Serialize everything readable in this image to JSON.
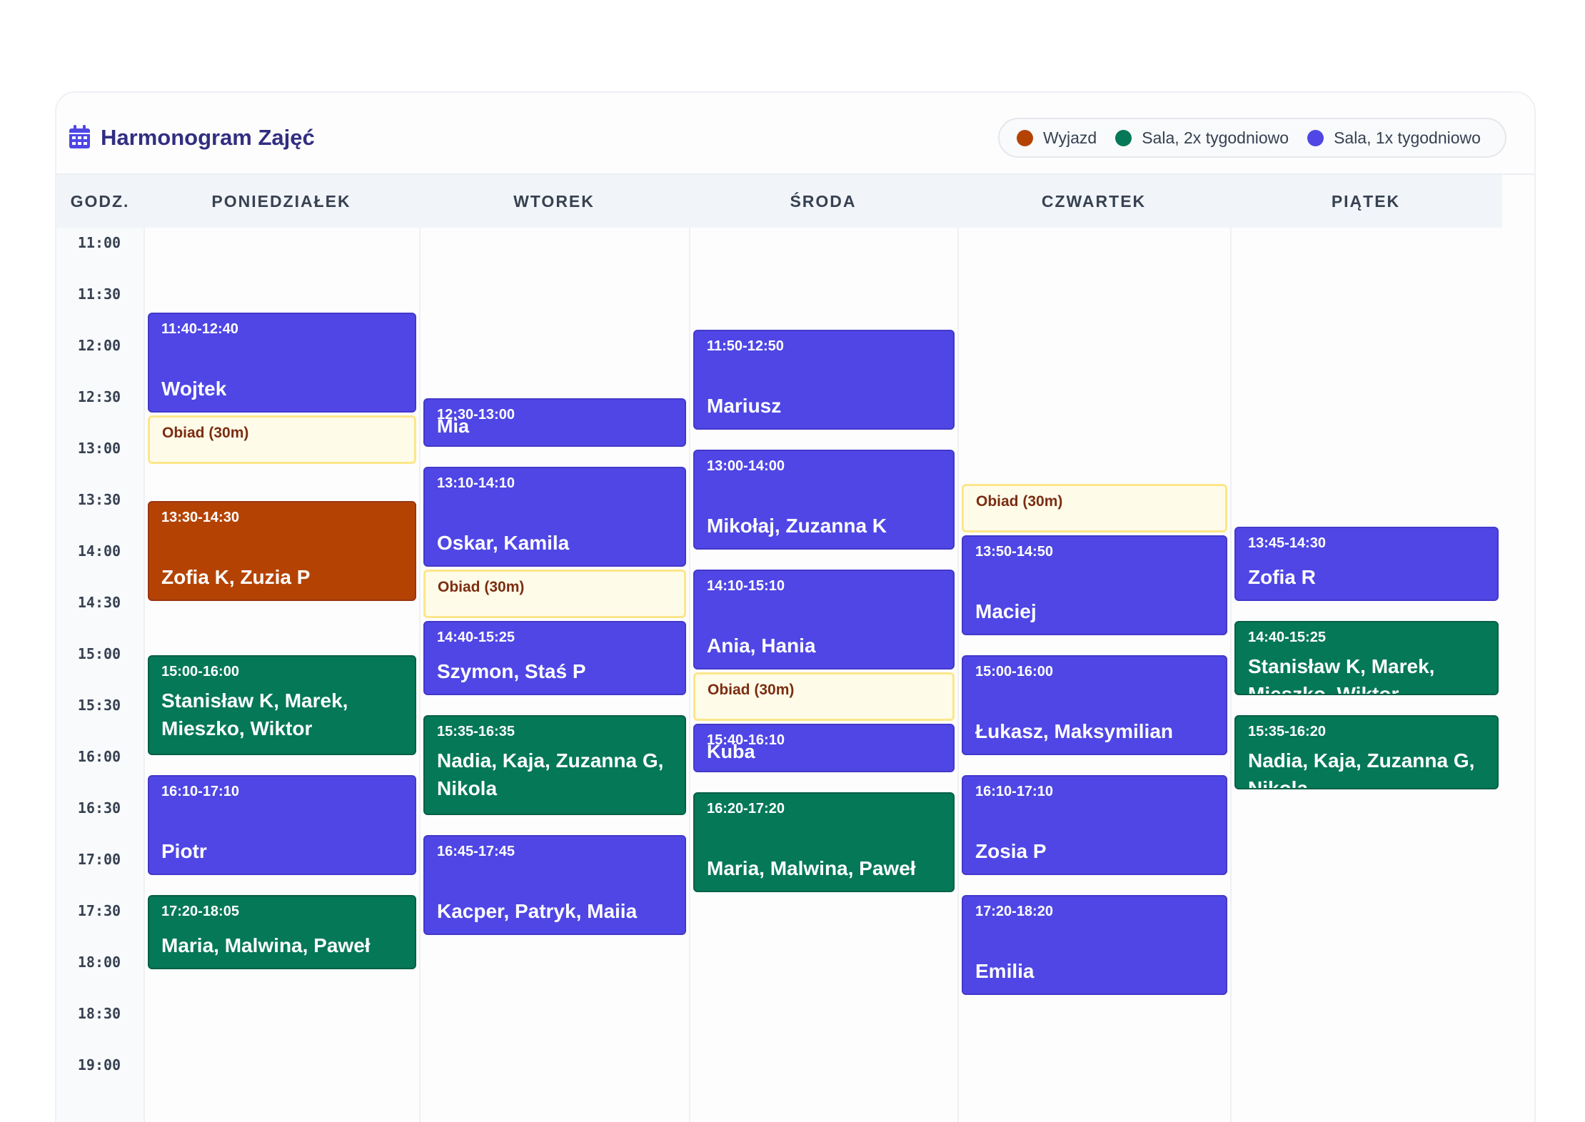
{
  "title": "Harmonogram Zajęć",
  "legend": [
    {
      "label": "Wyjazd",
      "color": "#b44303"
    },
    {
      "label": "Sala, 2x tygodniowo",
      "color": "#047857"
    },
    {
      "label": "Sala, 1x tygodniowo",
      "color": "#4f46e5"
    }
  ],
  "columns": {
    "time": "GODZ.",
    "days": [
      "PONIEDZIAŁEK",
      "WTOREK",
      "ŚRODA",
      "CZWARTEK",
      "PIĄTEK"
    ]
  },
  "times": [
    "11:00",
    "11:30",
    "12:00",
    "12:30",
    "13:00",
    "13:30",
    "14:00",
    "14:30",
    "15:00",
    "15:30",
    "16:00",
    "16:30",
    "17:00",
    "17:30",
    "18:00",
    "18:30",
    "19:00"
  ],
  "colors": {
    "wyjazd": "#b44303",
    "sala2x": "#047857",
    "sala1x": "#4f46e5",
    "break": "#fefce8"
  },
  "events": [
    {
      "day": 0,
      "kind": "sala1x",
      "start": "11:40",
      "end": "12:40",
      "time": "11:40-12:40",
      "names": "Wojtek"
    },
    {
      "day": 0,
      "kind": "break",
      "start": "12:40",
      "end": "13:10",
      "time": "Obiad (30m)",
      "names": ""
    },
    {
      "day": 0,
      "kind": "wyjazd",
      "start": "13:30",
      "end": "14:30",
      "time": "13:30-14:30",
      "names": "Zofia K, Zuzia P"
    },
    {
      "day": 0,
      "kind": "sala2x",
      "start": "15:00",
      "end": "16:00",
      "time": "15:00-16:00",
      "names": "Stanisław K, Marek, Mieszko, Wiktor"
    },
    {
      "day": 0,
      "kind": "sala1x",
      "start": "16:10",
      "end": "17:10",
      "time": "16:10-17:10",
      "names": "Piotr"
    },
    {
      "day": 0,
      "kind": "sala2x",
      "start": "17:20",
      "end": "18:05",
      "time": "17:20-18:05",
      "names": "Maria, Malwina, Paweł"
    },
    {
      "day": 1,
      "kind": "sala1x",
      "start": "12:30",
      "end": "13:00",
      "time": "12:30-13:00",
      "names": "Mia"
    },
    {
      "day": 1,
      "kind": "sala1x",
      "start": "13:10",
      "end": "14:10",
      "time": "13:10-14:10",
      "names": "Oskar, Kamila"
    },
    {
      "day": 1,
      "kind": "break",
      "start": "14:10",
      "end": "14:40",
      "time": "Obiad (30m)",
      "names": ""
    },
    {
      "day": 1,
      "kind": "sala1x",
      "start": "14:40",
      "end": "15:25",
      "time": "14:40-15:25",
      "names": "Szymon, Staś P"
    },
    {
      "day": 1,
      "kind": "sala2x",
      "start": "15:35",
      "end": "16:35",
      "time": "15:35-16:35",
      "names": "Nadia, Kaja, Zuzanna G, Nikola"
    },
    {
      "day": 1,
      "kind": "sala1x",
      "start": "16:45",
      "end": "17:45",
      "time": "16:45-17:45",
      "names": "Kacper, Patryk, Maiia"
    },
    {
      "day": 2,
      "kind": "sala1x",
      "start": "11:50",
      "end": "12:50",
      "time": "11:50-12:50",
      "names": "Mariusz"
    },
    {
      "day": 2,
      "kind": "sala1x",
      "start": "13:00",
      "end": "14:00",
      "time": "13:00-14:00",
      "names": "Mikołaj, Zuzanna K"
    },
    {
      "day": 2,
      "kind": "sala1x",
      "start": "14:10",
      "end": "15:10",
      "time": "14:10-15:10",
      "names": "Ania, Hania"
    },
    {
      "day": 2,
      "kind": "break",
      "start": "15:10",
      "end": "15:40",
      "time": "Obiad (30m)",
      "names": ""
    },
    {
      "day": 2,
      "kind": "sala1x",
      "start": "15:40",
      "end": "16:10",
      "time": "15:40-16:10",
      "names": "Kuba"
    },
    {
      "day": 2,
      "kind": "sala2x",
      "start": "16:20",
      "end": "17:20",
      "time": "16:20-17:20",
      "names": "Maria, Malwina, Paweł"
    },
    {
      "day": 3,
      "kind": "break",
      "start": "13:20",
      "end": "13:50",
      "time": "Obiad (30m)",
      "names": ""
    },
    {
      "day": 3,
      "kind": "sala1x",
      "start": "13:50",
      "end": "14:50",
      "time": "13:50-14:50",
      "names": "Maciej"
    },
    {
      "day": 3,
      "kind": "sala1x",
      "start": "15:00",
      "end": "16:00",
      "time": "15:00-16:00",
      "names": "Łukasz, Maksymilian"
    },
    {
      "day": 3,
      "kind": "sala1x",
      "start": "16:10",
      "end": "17:10",
      "time": "16:10-17:10",
      "names": "Zosia P"
    },
    {
      "day": 3,
      "kind": "sala1x",
      "start": "17:20",
      "end": "18:20",
      "time": "17:20-18:20",
      "names": "Emilia"
    },
    {
      "day": 4,
      "kind": "sala1x",
      "start": "13:45",
      "end": "14:30",
      "time": "13:45-14:30",
      "names": "Zofia R"
    },
    {
      "day": 4,
      "kind": "sala2x",
      "start": "14:40",
      "end": "15:25",
      "time": "14:40-15:25",
      "names": "Stanisław K, Marek, Mieszko, Wiktor"
    },
    {
      "day": 4,
      "kind": "sala2x",
      "start": "15:35",
      "end": "16:20",
      "time": "15:35-16:20",
      "names": "Nadia, Kaja, Zuzanna G, Nikola"
    }
  ]
}
